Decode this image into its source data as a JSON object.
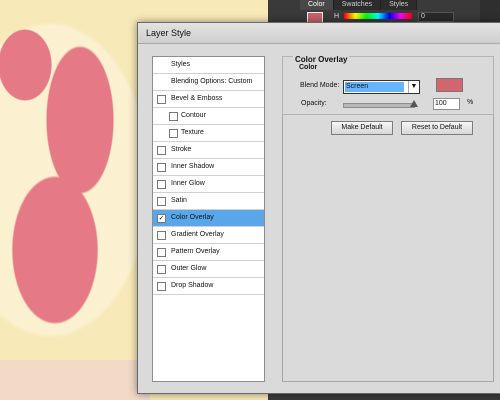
{
  "app": {
    "panel_tabs": [
      "Color",
      "Swatches",
      "Styles"
    ],
    "color_panel": {
      "hue_label": "H",
      "hue_value": "0"
    }
  },
  "dialog": {
    "title": "Layer Style",
    "styles_list": [
      {
        "label": "Styles",
        "type": "header"
      },
      {
        "label": "Blending Options: Custom",
        "type": "header"
      },
      {
        "label": "Bevel & Emboss",
        "checked": false
      },
      {
        "label": "Contour",
        "checked": false,
        "indent": true
      },
      {
        "label": "Texture",
        "checked": false,
        "indent": true
      },
      {
        "label": "Stroke",
        "checked": false
      },
      {
        "label": "Inner Shadow",
        "checked": false
      },
      {
        "label": "Inner Glow",
        "checked": false
      },
      {
        "label": "Satin",
        "checked": false
      },
      {
        "label": "Color Overlay",
        "checked": true,
        "selected": true
      },
      {
        "label": "Gradient Overlay",
        "checked": false
      },
      {
        "label": "Pattern Overlay",
        "checked": false
      },
      {
        "label": "Outer Glow",
        "checked": false
      },
      {
        "label": "Drop Shadow",
        "checked": false
      }
    ],
    "section_title": "Color Overlay",
    "subsection_title": "Color",
    "blend_mode_label": "Blend Mode:",
    "blend_mode_value": "Screen",
    "overlay_color": "#d3656f",
    "opacity_label": "Opacity:",
    "opacity_value": "100",
    "opacity_unit": "%",
    "buttons": {
      "make_default": "Make Default",
      "reset_to_default": "Reset to Default"
    }
  }
}
